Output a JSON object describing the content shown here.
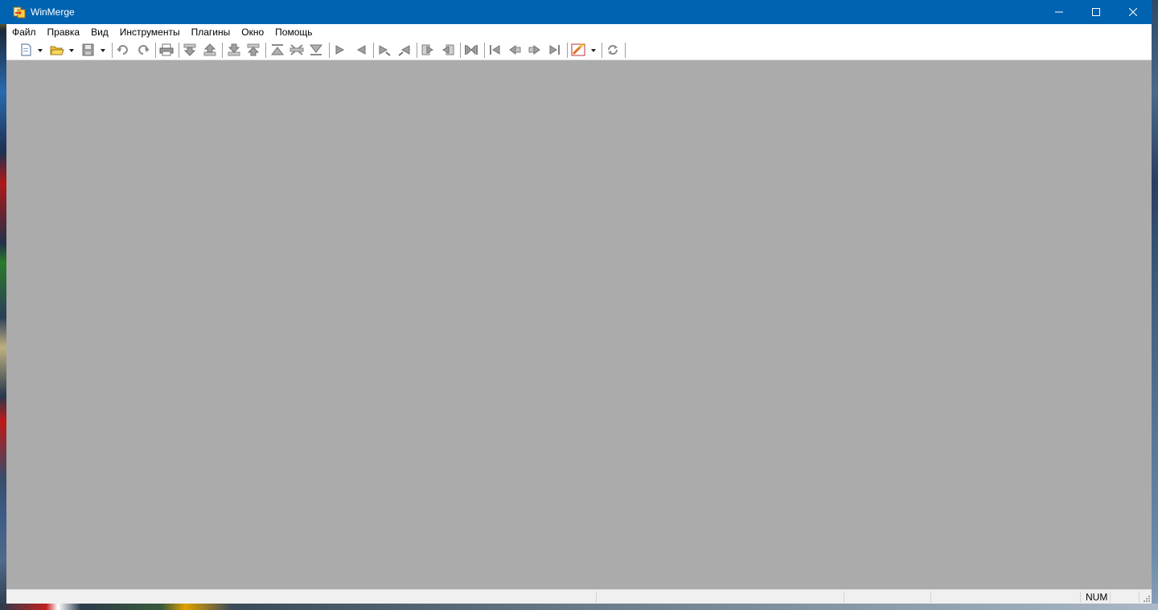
{
  "window": {
    "title": "WinMerge",
    "app_icon": "winmerge-icon",
    "controls": [
      "minimize-icon",
      "maximize-icon",
      "close-icon"
    ]
  },
  "menu": [
    {
      "label": "Файл"
    },
    {
      "label": "Правка"
    },
    {
      "label": "Вид"
    },
    {
      "label": "Инструменты"
    },
    {
      "label": "Плагины"
    },
    {
      "label": "Окно"
    },
    {
      "label": "Помощь"
    }
  ],
  "toolbar": {
    "buttons": [
      "new-icon",
      "open-icon",
      "save-icon",
      "undo-icon",
      "redo-icon",
      "print-icon",
      "next-diff-icon",
      "prev-diff-icon",
      "next-conflict-icon",
      "prev-conflict-icon",
      "first-diff-icon",
      "current-diff-icon",
      "last-diff-icon",
      "copy-right-icon",
      "copy-left-icon",
      "copy-right-advance-icon",
      "copy-left-advance-icon",
      "copy-all-right-icon",
      "copy-all-left-icon",
      "merge-all-icon",
      "first-file-icon",
      "prev-file-icon",
      "next-file-icon",
      "last-file-icon",
      "options-icon",
      "refresh-icon"
    ]
  },
  "statusbar": {
    "num": "NUM"
  },
  "colors": {
    "titlebar": "#0063b1",
    "client": "#ababab",
    "chrome": "#f0f0f0"
  }
}
